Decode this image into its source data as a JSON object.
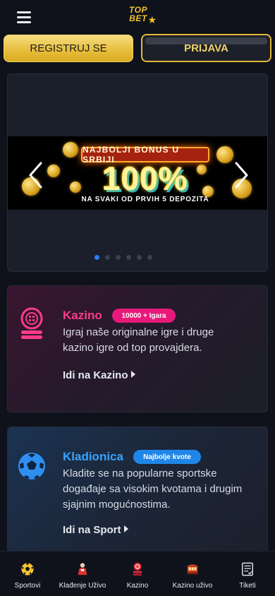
{
  "header": {
    "logo_line1": "TOP",
    "logo_line2": "BET",
    "register_label": "REGISTRUJ SE",
    "login_label": "PRIJAVA"
  },
  "banner": {
    "promo_tag": "NAJBOLJI BONUS U SRBIJI",
    "promo_big": "100%",
    "promo_sub": "NA SVAKI OD PRVIH 5 DEPOZITA",
    "slide_count": 6,
    "active_slide": 1
  },
  "cards": {
    "kazino": {
      "title": "Kazino",
      "badge": "10000 + Igara",
      "description": "Igraj naše originalne igre i druge kazino igre od top provajdera.",
      "link": "Idi na Kazino"
    },
    "sport": {
      "title": "Kladionica",
      "badge": "Najbolje kvote",
      "description": "Kladite se na popularne sportske događaje sa visokim kvotama i drugim sjajnim mogućnostima.",
      "link": "Idi na Sport"
    }
  },
  "bottom_nav": {
    "items": [
      {
        "label": "Sportovi",
        "icon": "soccer-ball-icon"
      },
      {
        "label": "Klađenje Uživo",
        "icon": "live-player-icon"
      },
      {
        "label": "Kazino",
        "icon": "casino-chip-icon"
      },
      {
        "label": "Kazino uživo",
        "icon": "live-casino-icon"
      },
      {
        "label": "Tiketi",
        "icon": "ticket-icon"
      }
    ]
  },
  "colors": {
    "gold": "#e7bd3a",
    "kazino_accent": "#ff3a8c",
    "sport_accent": "#3aa2ff",
    "active_dot": "#2f7bf0"
  }
}
